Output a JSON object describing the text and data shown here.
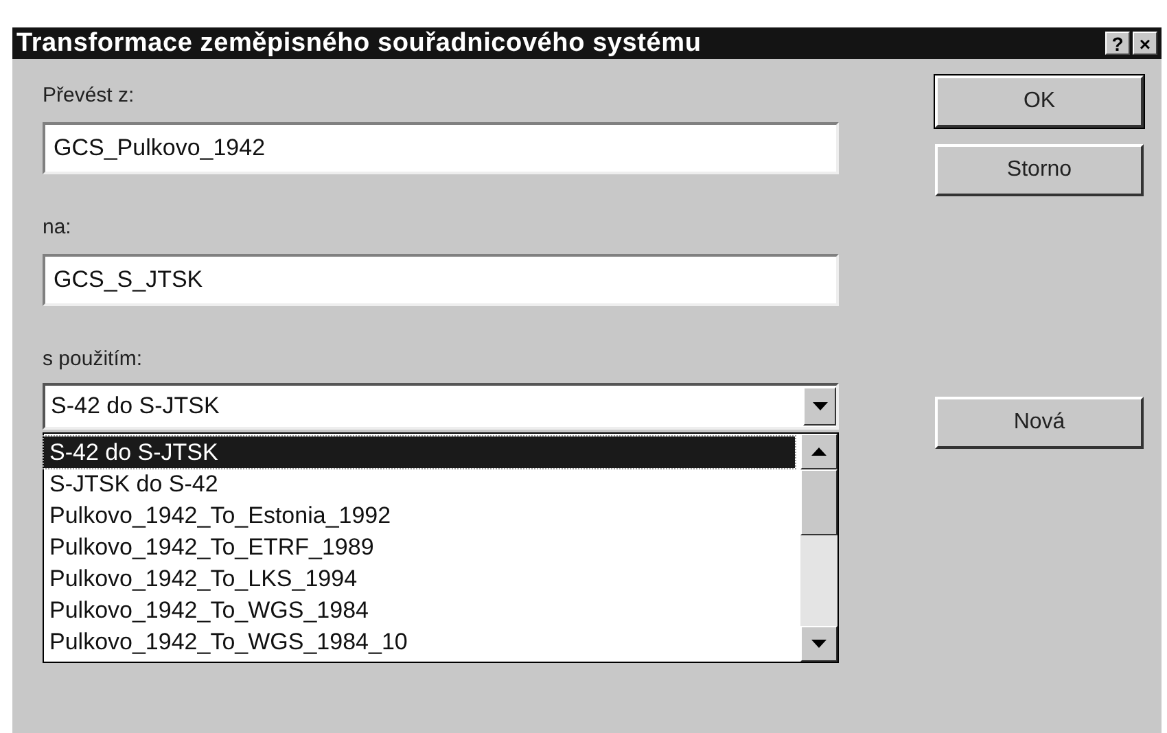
{
  "window": {
    "title": "Transformace zeměpisného souřadnicového systému",
    "title_buttons": [
      "?",
      "×"
    ]
  },
  "from": {
    "label": "Převést z:",
    "value": "GCS_Pulkovo_1942"
  },
  "to": {
    "label": "na:",
    "value": "GCS_S_JTSK"
  },
  "using": {
    "label": "s použitím:",
    "value": "S-42 do S-JTSK",
    "options": [
      {
        "label": "S-42 do S-JTSK",
        "selected": true
      },
      {
        "label": "S-JTSK do S-42",
        "selected": false
      },
      {
        "label": "Pulkovo_1942_To_Estonia_1992",
        "selected": false
      },
      {
        "label": "Pulkovo_1942_To_ETRF_1989",
        "selected": false
      },
      {
        "label": "Pulkovo_1942_To_LKS_1994",
        "selected": false
      },
      {
        "label": "Pulkovo_1942_To_WGS_1984",
        "selected": false
      },
      {
        "label": "Pulkovo_1942_To_WGS_1984_10",
        "selected": false
      }
    ]
  },
  "buttons": [
    "OK",
    "Storno"
  ],
  "new_button": "Nová"
}
